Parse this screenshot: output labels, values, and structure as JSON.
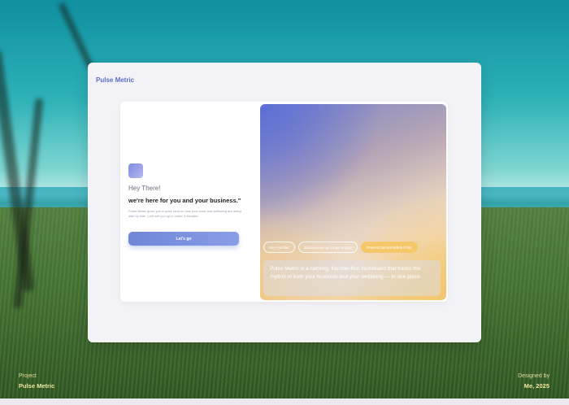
{
  "app": {
    "brand": "Pulse Metric"
  },
  "onboarding": {
    "greeting": "Hey There!",
    "headline": "we're here for you and your business.\"",
    "description": "Pulse Metric gives you a quick read on how your work and wellbeing are doing side by side. Let's set you up in under 2 minutes.",
    "cta_label": "Let's go"
  },
  "visual": {
    "chips": [
      {
        "label": "Hey Founder",
        "accent": false
      },
      {
        "label": "Stress levels up 3 days straight",
        "accent": false
      },
      {
        "label": "Prevent burnout before it hits",
        "accent": true
      }
    ],
    "caption": "Pulse Metric is a calming, founder-first dashboard that tracks the rhythm of both your business and your wellbeing — in one place."
  },
  "footer": {
    "left_label": "Project",
    "left_value": "Pulse Metric",
    "right_label": "Designed by",
    "right_value": "Me, 2025"
  },
  "colors": {
    "brand": "#5a6fc8",
    "cta": "#6f86d8",
    "accent_chip": "#f4c86a",
    "footer_text": "#f1e8a4"
  }
}
